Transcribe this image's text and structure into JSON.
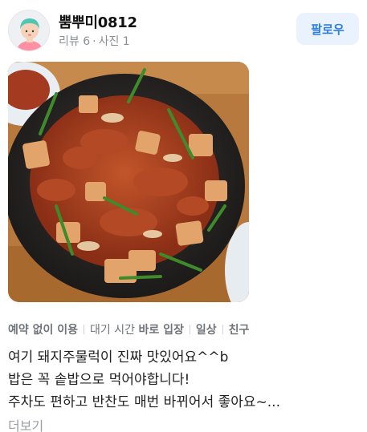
{
  "profile": {
    "username": "뿜뿌미0812",
    "reviews_label": "리뷰 6",
    "separator": "·",
    "photos_label": "사진 1",
    "follow_label": "팔로우",
    "avatar_icon": "avatar-icon"
  },
  "photo": {
    "subject": "food-photo"
  },
  "tags": {
    "reservation": "예약 없이 이용",
    "wait_prefix": "대기 시간",
    "wait_value": "바로 입장",
    "purpose": "일상",
    "companion": "친구"
  },
  "review": {
    "line1": "여기 돼지주물럭이 진짜 맛있어요^^b",
    "line2": "밥은 꼭 솥밥으로 먹어야합니다!",
    "line3": "주차도 편하고 반찬도 매번 바뀌어서 좋아요~...",
    "more_label": "더보기"
  },
  "colors": {
    "follow_bg": "#eaf3fd",
    "follow_text": "#2f7fe0",
    "meta_text": "#8a8f96"
  }
}
